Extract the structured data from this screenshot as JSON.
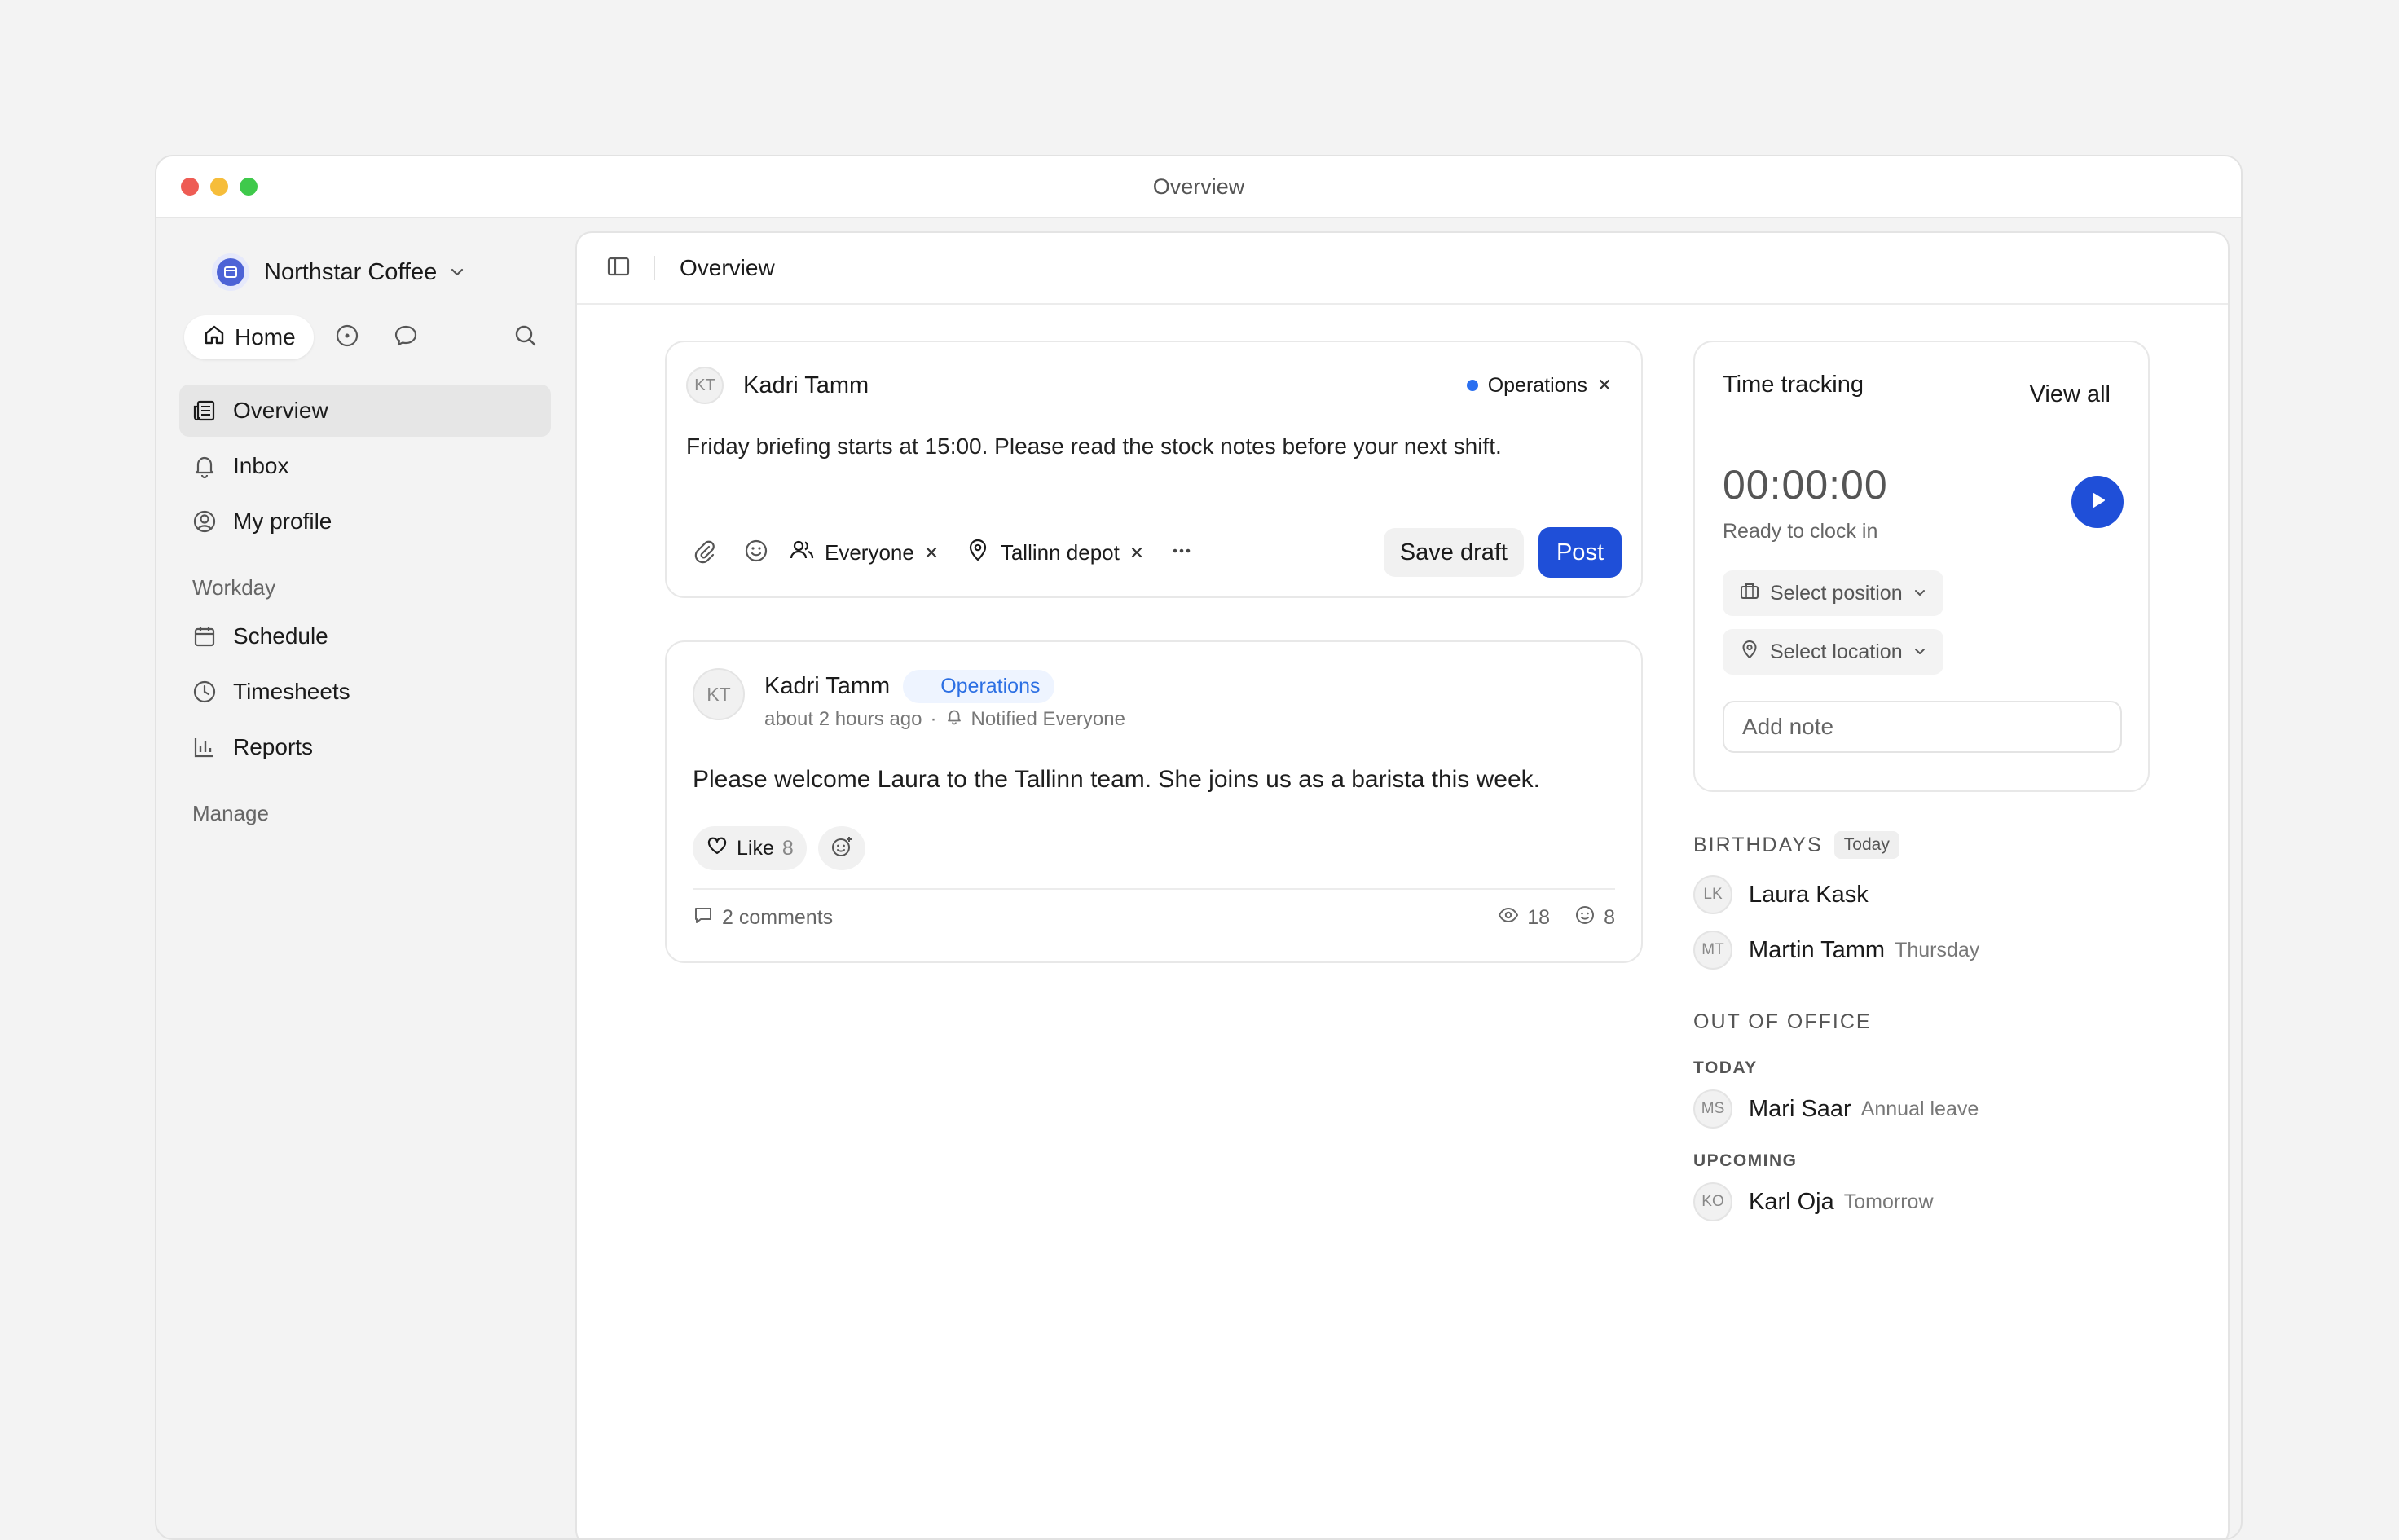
{
  "window": {
    "title": "Overview"
  },
  "sidebar": {
    "org_name": "Northstar Coffee",
    "home_label": "Home",
    "items": [
      {
        "label": "Overview",
        "icon": "newspaper-icon",
        "active": true
      },
      {
        "label": "Inbox",
        "icon": "bell-icon"
      },
      {
        "label": "My profile",
        "icon": "user-circle-icon"
      }
    ],
    "workday_label": "Workday",
    "workday_items": [
      {
        "label": "Schedule",
        "icon": "calendar-icon"
      },
      {
        "label": "Timesheets",
        "icon": "clock-icon"
      },
      {
        "label": "Reports",
        "icon": "bar-chart-icon"
      }
    ],
    "manage_label": "Manage"
  },
  "main": {
    "title": "Overview"
  },
  "composer": {
    "avatar_initials": "KT",
    "author": "Kadri Tamm",
    "group_tag": "Operations",
    "text": "Friday briefing starts at 15:00. Please read the stock notes before your next shift.",
    "audience": "Everyone",
    "location": "Tallinn depot",
    "save_draft_label": "Save draft",
    "post_label": "Post"
  },
  "post": {
    "avatar_initials": "KT",
    "author": "Kadri Tamm",
    "group_tag": "Operations",
    "time": "about 2 hours ago",
    "notified": "Notified Everyone",
    "body": "Please welcome Laura to the Tallinn team. She joins us as a barista this week.",
    "like_label": "Like",
    "like_count": "8",
    "comments": "2 comments",
    "views": "18",
    "reactions": "8"
  },
  "time_tracking": {
    "title": "Time tracking",
    "view_all": "View all",
    "clock": "00:00:00",
    "status": "Ready to clock in",
    "select_position": "Select position",
    "select_location": "Select location",
    "note_placeholder": "Add note"
  },
  "birthdays": {
    "heading": "BIRTHDAYS",
    "badge": "Today",
    "people": [
      {
        "initials": "LK",
        "name": "Laura Kask",
        "note": ""
      },
      {
        "initials": "MT",
        "name": "Martin Tamm",
        "note": "Thursday"
      }
    ]
  },
  "out_of_office": {
    "heading": "OUT OF OFFICE",
    "today_label": "TODAY",
    "today": [
      {
        "initials": "MS",
        "name": "Mari Saar",
        "note": "Annual leave"
      }
    ],
    "upcoming_label": "UPCOMING",
    "upcoming": [
      {
        "initials": "KO",
        "name": "Karl Oja",
        "note": "Tomorrow"
      }
    ]
  },
  "colors": {
    "accent": "#1f4fd8",
    "tag_blue": "#2c6fe3"
  }
}
